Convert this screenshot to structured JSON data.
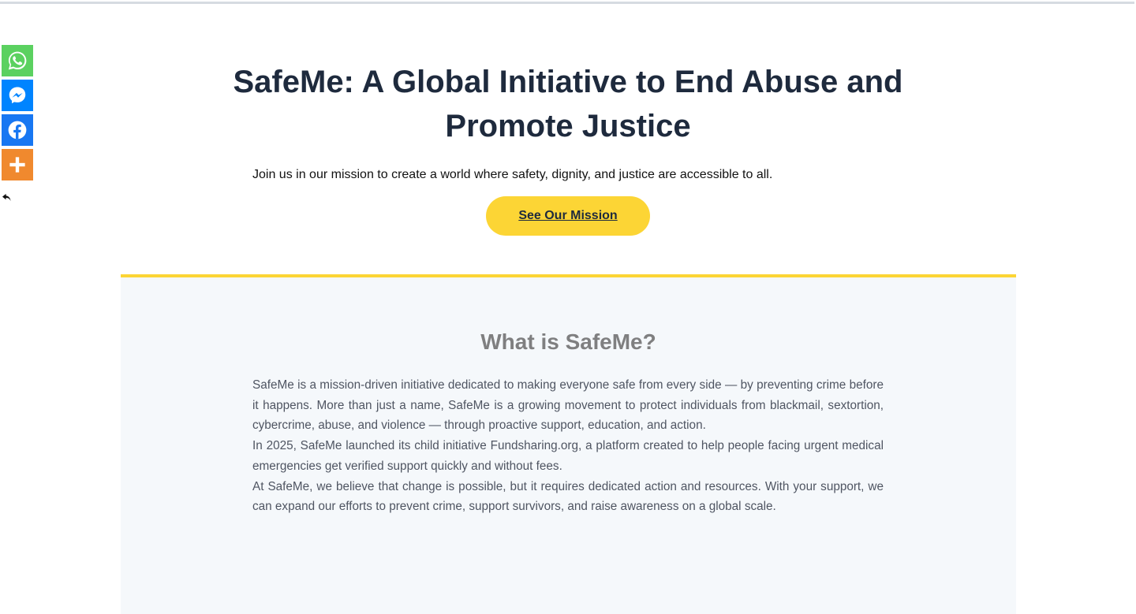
{
  "share": {
    "buttons": [
      {
        "name": "whatsapp",
        "color": "#5bd160",
        "icon": "whatsapp-icon"
      },
      {
        "name": "messenger",
        "color": "#0084ff",
        "icon": "messenger-icon"
      },
      {
        "name": "facebook",
        "color": "#1877f2",
        "icon": "facebook-icon"
      },
      {
        "name": "more",
        "color": "#f0892e",
        "icon": "plus-icon"
      }
    ]
  },
  "hero": {
    "title": "SafeMe: A Global Initiative to End Abuse and Promote Justice",
    "subtitle": "Join us in our mission to create a world where safety, dignity, and justice are accessible to all.",
    "cta_label": "See Our Mission"
  },
  "about": {
    "title": "What is SafeMe?",
    "paragraphs": [
      "SafeMe is a mission-driven initiative dedicated to making everyone safe from every side — by preventing crime before it happens. More than just a name, SafeMe is a growing movement to protect individuals from blackmail, sextortion, cybercrime, abuse, and violence — through proactive support, education, and action.",
      "In 2025, SafeMe launched its child initiative Fundsharing.org, a platform created to help people facing urgent medical emergencies get verified support quickly and without fees.",
      "At SafeMe, we believe that change is possible, but it requires dedicated action and resources. With your support, we can expand our efforts to prevent crime, support survivors, and raise awareness on a global scale."
    ]
  },
  "colors": {
    "accent": "#fcd535",
    "heading": "#1e2a3d",
    "section_bg": "#f5f8fb"
  }
}
